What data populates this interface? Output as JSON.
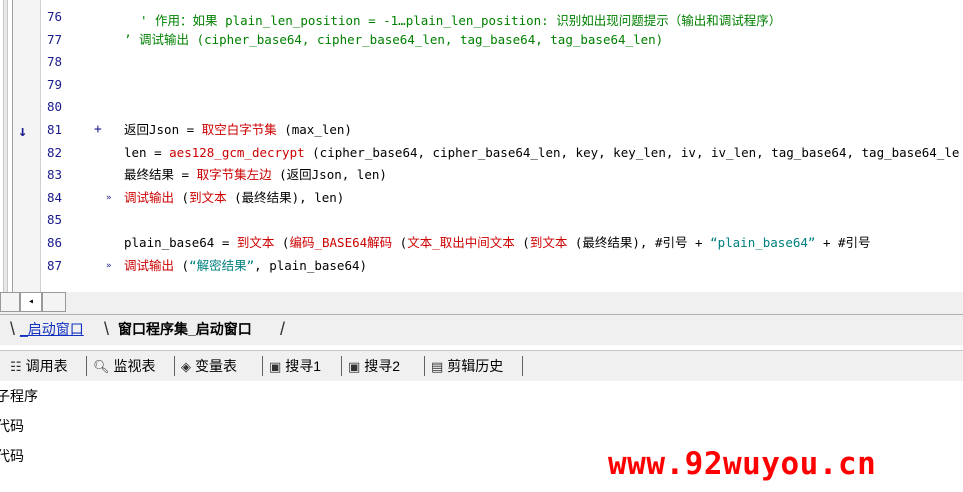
{
  "editor": {
    "top_partial": "' 作用：如果 plain_len_position = -1…plain_len_position: 识别如出现问题提示（输出和调试程序）",
    "lines": [
      {
        "num": "76",
        "marker": "",
        "segments": []
      },
      {
        "num": "77",
        "marker": "",
        "segments": [
          {
            "cls": "c-comment",
            "text": "’ 调试输出 (cipher_base64, cipher_base64_len, tag_base64, tag_base64_len)"
          }
        ]
      },
      {
        "num": "78",
        "marker": "",
        "segments": []
      },
      {
        "num": "79",
        "marker": "",
        "segments": []
      },
      {
        "num": "80",
        "marker": "",
        "segments": []
      },
      {
        "num": "81",
        "marker": "+",
        "segments": [
          {
            "cls": "c-plain",
            "text": "返回Json = "
          },
          {
            "cls": "c-func",
            "text": "取空白字节集"
          },
          {
            "cls": "c-plain",
            "text": " (max_len)"
          }
        ]
      },
      {
        "num": "82",
        "marker": "",
        "segments": [
          {
            "cls": "c-plain",
            "text": "len = "
          },
          {
            "cls": "c-func",
            "text": "aes128_gcm_decrypt"
          },
          {
            "cls": "c-plain",
            "text": " (cipher_base64, cipher_base64_len, key, key_len, iv, iv_len, tag_base64, tag_base64_le"
          }
        ]
      },
      {
        "num": "83",
        "marker": "",
        "segments": [
          {
            "cls": "c-plain",
            "text": "最终结果 = "
          },
          {
            "cls": "c-func",
            "text": "取字节集左边"
          },
          {
            "cls": "c-plain",
            "text": " (返回Json, len)"
          }
        ]
      },
      {
        "num": "84",
        "marker": "»",
        "segments": [
          {
            "cls": "c-func",
            "text": "调试输出"
          },
          {
            "cls": "c-plain",
            "text": " ("
          },
          {
            "cls": "c-func",
            "text": "到文本"
          },
          {
            "cls": "c-plain",
            "text": " (最终结果), len)"
          }
        ]
      },
      {
        "num": "85",
        "marker": "",
        "segments": []
      },
      {
        "num": "86",
        "marker": "",
        "segments": [
          {
            "cls": "c-plain",
            "text": "plain_base64 = "
          },
          {
            "cls": "c-func",
            "text": "到文本"
          },
          {
            "cls": "c-plain",
            "text": " ("
          },
          {
            "cls": "c-func",
            "text": "编码_BASE64解码"
          },
          {
            "cls": "c-plain",
            "text": " ("
          },
          {
            "cls": "c-func",
            "text": "文本_取出中间文本"
          },
          {
            "cls": "c-plain",
            "text": " ("
          },
          {
            "cls": "c-func",
            "text": "到文本"
          },
          {
            "cls": "c-plain",
            "text": " (最终结果), #引号 + "
          },
          {
            "cls": "c-str",
            "text": "“plain_base64”"
          },
          {
            "cls": "c-plain",
            "text": " + #引号"
          }
        ]
      },
      {
        "num": "87",
        "marker": "»",
        "segments": [
          {
            "cls": "c-func",
            "text": "调试输出"
          },
          {
            "cls": "c-plain",
            "text": " ("
          },
          {
            "cls": "c-str",
            "text": "“解密结果”"
          },
          {
            "cls": "c-plain",
            "text": ", plain_base64)"
          }
        ]
      }
    ],
    "arrow_icon": "down-arrow"
  },
  "tabs": [
    {
      "label": "_启动窗口",
      "active": false
    },
    {
      "label": "窗口程序集_启动窗口",
      "active": true
    }
  ],
  "toolbar": [
    {
      "icon": "list-icon",
      "glyph": "☷",
      "label": "调用表"
    },
    {
      "icon": "search-icon",
      "glyph": "🔍︎",
      "label": "监视表"
    },
    {
      "icon": "variables-icon",
      "glyph": "◈",
      "label": "变量表"
    },
    {
      "icon": "find-icon",
      "glyph": "▣",
      "label": "搜寻1"
    },
    {
      "icon": "find-icon",
      "glyph": "▣",
      "label": "搜寻2"
    },
    {
      "icon": "clipboard-icon",
      "glyph": "▤",
      "label": "剪辑历史"
    }
  ],
  "panel": [
    {
      "label": "子程序"
    },
    {
      "label": "代码"
    },
    {
      "label": "代码"
    }
  ],
  "watermark": "www.92wuyou.cn",
  "colors": {
    "comment": "#008000",
    "function": "#cc0000",
    "string": "#008080",
    "linenum": "#1a1a8c",
    "watermark": "#ff0000"
  }
}
